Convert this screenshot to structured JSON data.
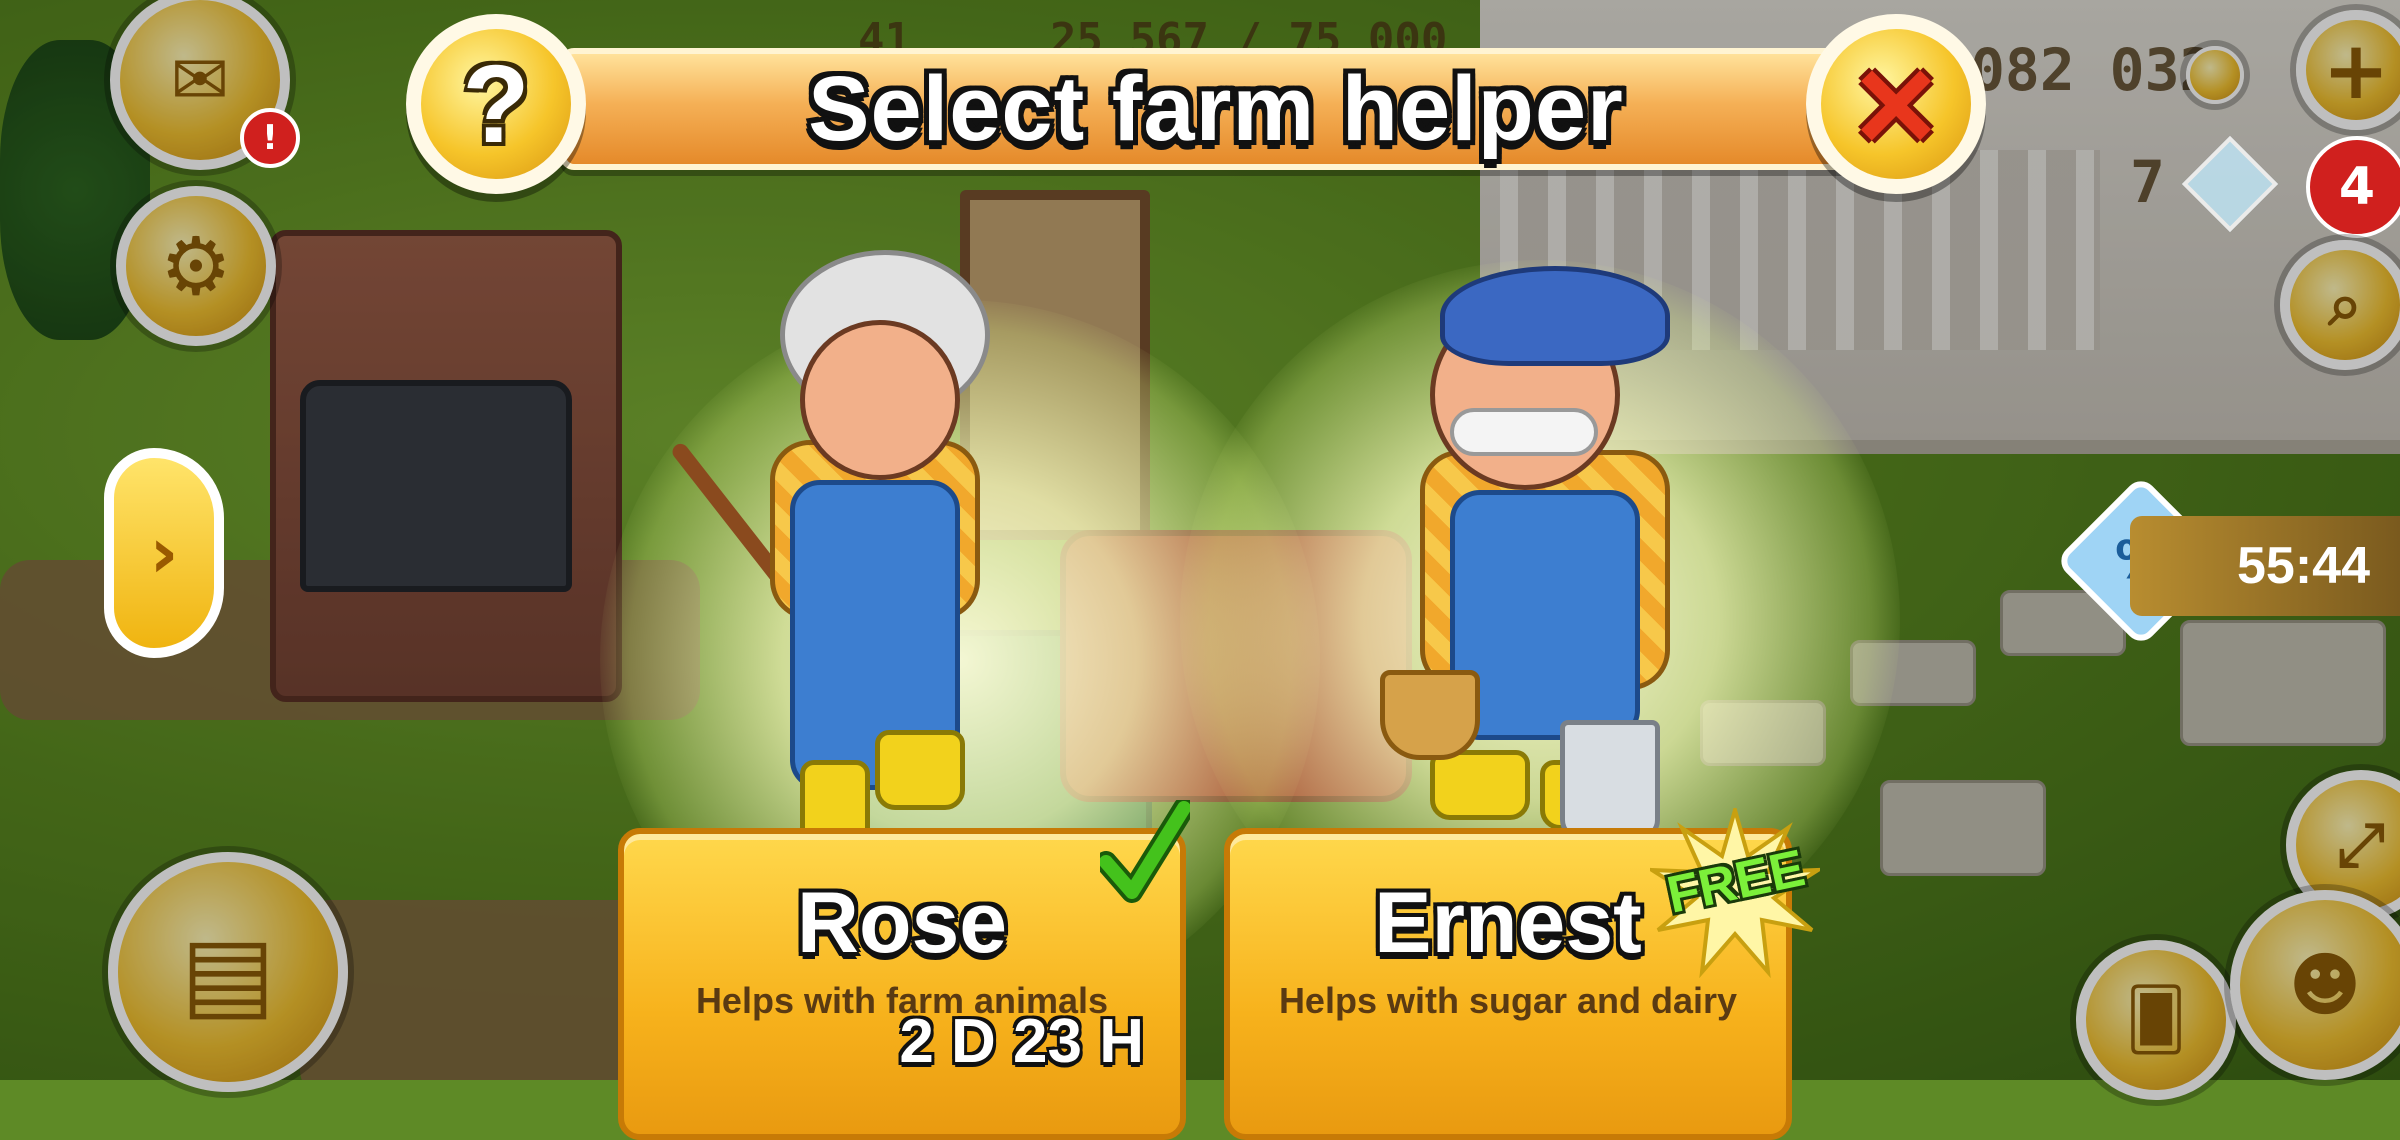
{
  "header": {
    "title": "Select farm helper",
    "help_symbol": "?",
    "close_symbol": "×"
  },
  "hud": {
    "coins_partial": "082 032",
    "xp_partial": "25 567 / 75 000",
    "level_partial": "41",
    "diamonds": "7",
    "notifications_count": "4",
    "mail_badge": "!",
    "sale_timer": "55:44",
    "sale_symbol": "%",
    "side_arrow": "›",
    "add_symbol": "+"
  },
  "helpers": [
    {
      "name": "Rose",
      "description": "Helps with farm animals",
      "timer": "2 D 23 H",
      "selected": true
    },
    {
      "name": "Ernest",
      "description": "Helps with sugar and dairy",
      "badge": "FREE"
    }
  ],
  "icons": {
    "help": "question-mark-icon",
    "close": "close-x-icon",
    "mail": "envelope-icon",
    "settings": "gear-icon",
    "shop": "cash-register-icon",
    "add": "plus-icon",
    "search": "magnifier-icon",
    "fullscreen": "expand-icon",
    "cards": "cards-icon",
    "friends": "friends-icon",
    "check": "check-mark-icon",
    "coin": "coin-icon",
    "diamond": "diamond-icon"
  },
  "colors": {
    "banner": "#f5b056",
    "card": "#f7b21c",
    "close_red": "#e8361c",
    "check_green": "#44c21c",
    "free_green": "#7cf03a"
  }
}
